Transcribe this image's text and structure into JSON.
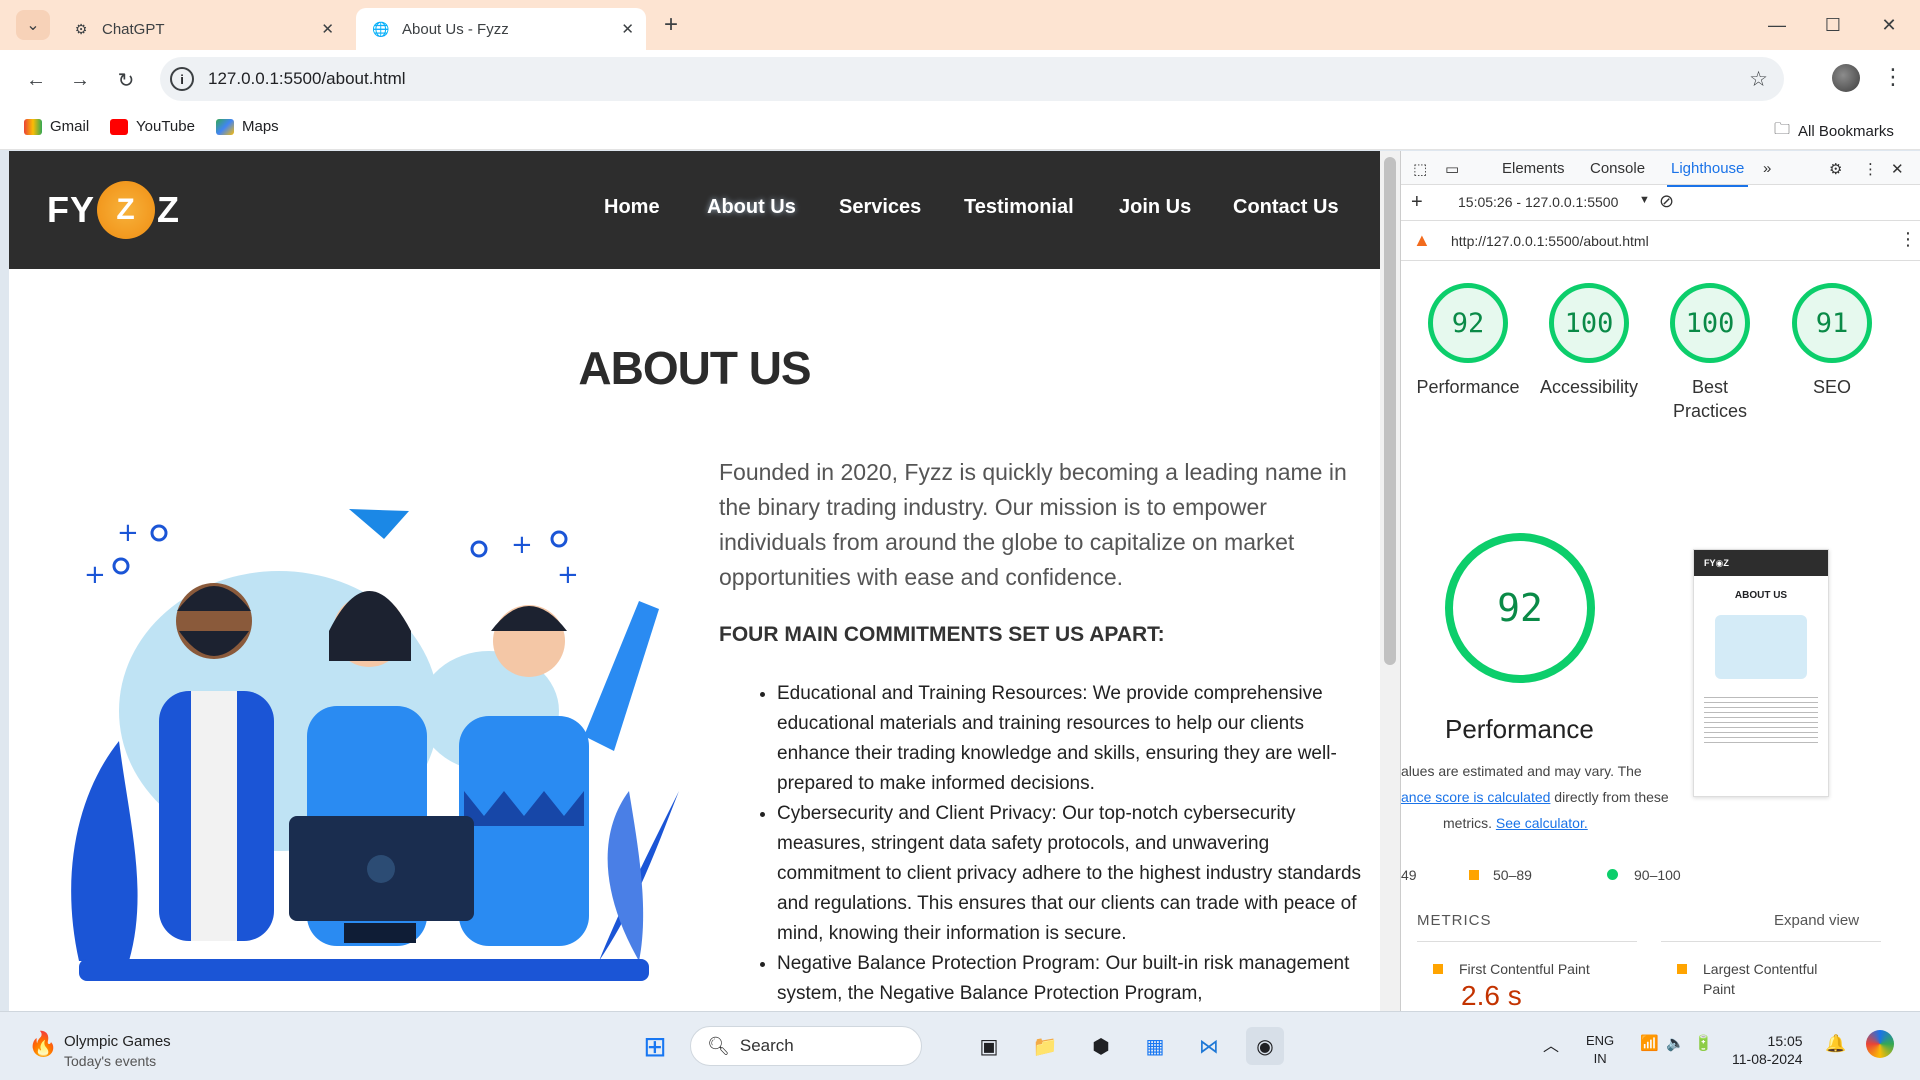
{
  "browser": {
    "tabs": [
      {
        "title": "ChatGPT",
        "active": false
      },
      {
        "title": "About Us - Fyzz",
        "active": true
      }
    ],
    "url": "127.0.0.1:5500/about.html",
    "bookmarks": [
      "Gmail",
      "YouTube",
      "Maps"
    ],
    "all_bookmarks": "All Bookmarks"
  },
  "site": {
    "logo": {
      "left": "FY",
      "center": "Z",
      "right": "Z"
    },
    "nav": [
      "Home",
      "About Us",
      "Services",
      "Testimonial",
      "Join Us",
      "Contact Us"
    ],
    "active_nav": "About Us",
    "heading": "ABOUT US",
    "intro": "Founded in 2020, Fyzz is quickly becoming a leading name in the binary trading industry. Our mission is to empower individuals from around the globe to capitalize on market opportunities with ease and confidence.",
    "subheading": "FOUR MAIN COMMITMENTS SET US APART:",
    "commitments": [
      "Educational and Training Resources: We provide comprehensive educational materials and training resources to help our clients enhance their trading knowledge and skills, ensuring they are well-prepared to make informed decisions.",
      "Cybersecurity and Client Privacy: Our top-notch cybersecurity measures, stringent data safety protocols, and unwavering commitment to client privacy adhere to the highest industry standards and regulations. This ensures that our clients can trade with peace of mind, knowing their information is secure.",
      "Negative Balance Protection Program: Our built-in risk management system, the Negative Balance Protection Program,"
    ]
  },
  "devtools": {
    "tabs": [
      "Elements",
      "Console",
      "Lighthouse"
    ],
    "selected_tab": "Lighthouse",
    "report_selector": "15:05:26 - 127.0.0.1:5500",
    "report_url": "http://127.0.0.1:5500/about.html",
    "scores": [
      {
        "label": "Performance",
        "value": "92"
      },
      {
        "label": "Accessibility",
        "value": "100"
      },
      {
        "label": "Best Practices",
        "value": "100"
      },
      {
        "label": "SEO",
        "value": "91"
      }
    ],
    "big_score": "92",
    "big_label": "Performance",
    "note_1": "alues are estimated and may vary. The",
    "note_link": "ance score is calculated",
    "note_2": " directly from these",
    "note_3": "metrics. ",
    "note_link2": "See calculator.",
    "legend": [
      "49",
      "50–89",
      "90–100"
    ],
    "thumb_heading": "ABOUT US",
    "metrics_title": "METRICS",
    "expand": "Expand view",
    "metric_1": "First Contentful Paint",
    "metric_1_value": "2.6 s",
    "metric_2": "Largest Contentful Paint"
  },
  "taskbar": {
    "weather_title": "Olympic Games",
    "weather_sub": "Today's events",
    "search_placeholder": "Search",
    "lang_1": "ENG",
    "lang_2": "IN",
    "time": "15:05",
    "date": "11-08-2024"
  }
}
